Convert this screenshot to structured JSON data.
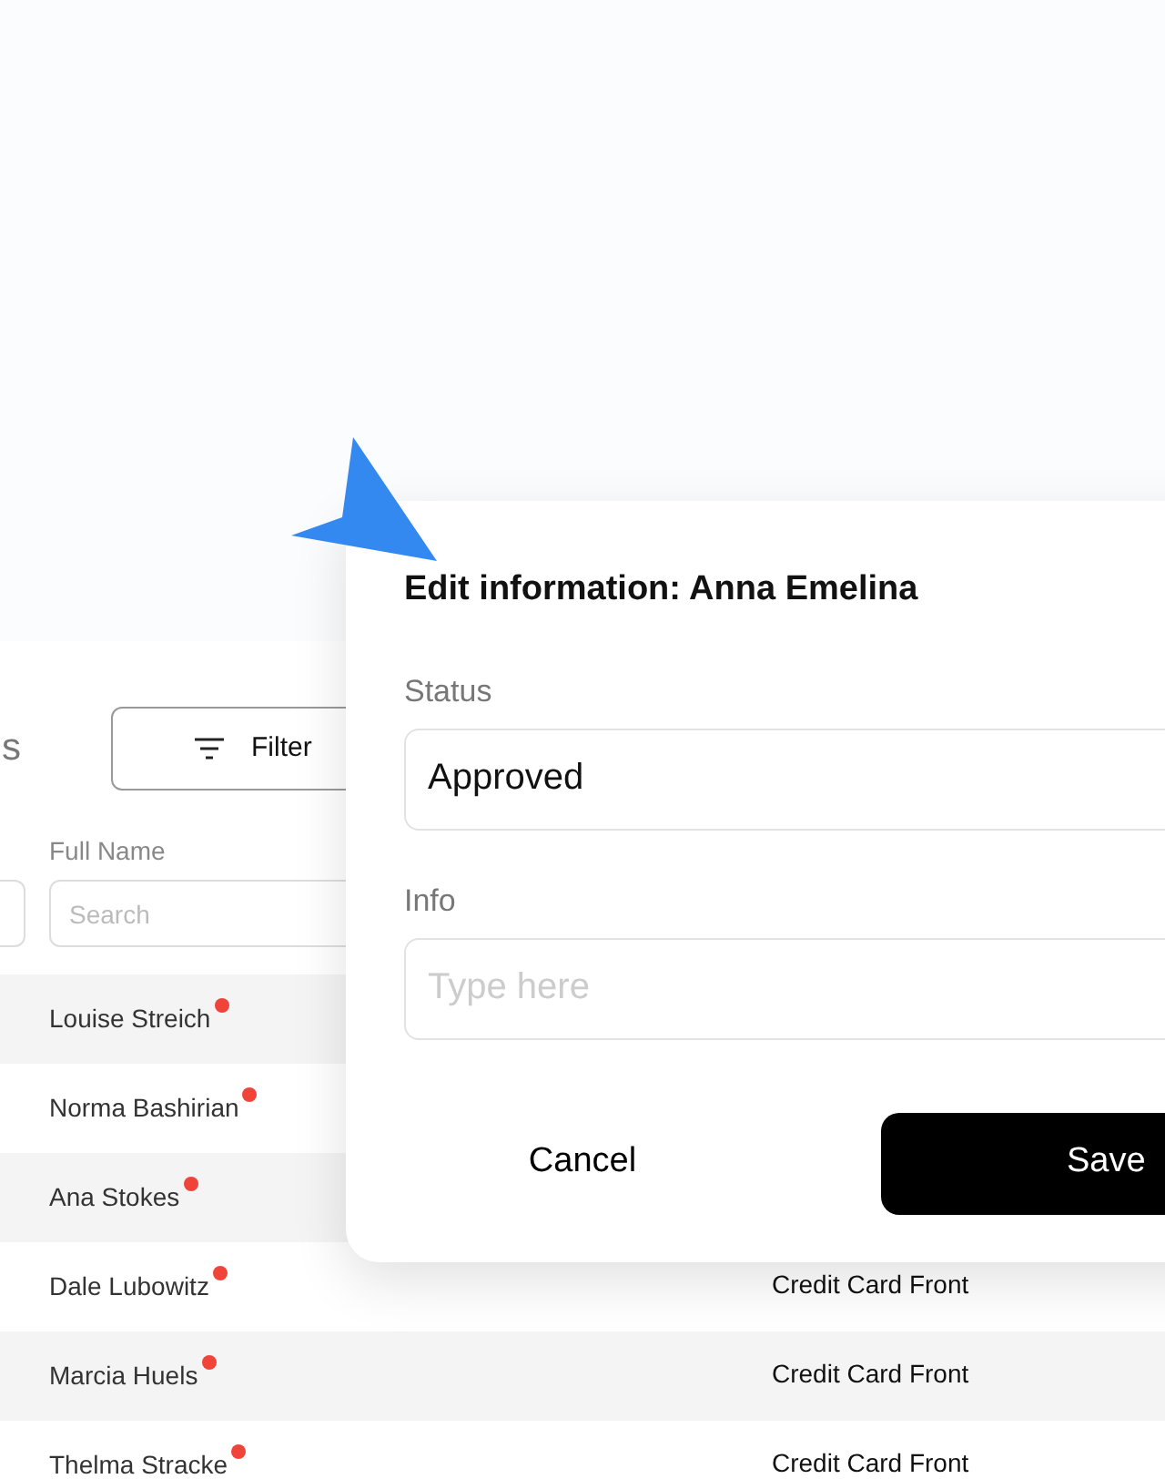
{
  "page_heading": "s",
  "filter_button": {
    "label": "Filter"
  },
  "table": {
    "column": {
      "label": "Full Name",
      "search_placeholder": "Search"
    },
    "rows": [
      {
        "full_name": "Louise Streich",
        "flagged": true
      },
      {
        "full_name": "Norma Bashirian",
        "flagged": true
      },
      {
        "full_name": "Ana Stokes",
        "flagged": true
      },
      {
        "full_name": "Dale Lubowitz",
        "flagged": true,
        "column_3": "Credit Card Front"
      },
      {
        "full_name": "Marcia Huels",
        "flagged": true,
        "column_3": "Credit Card Front"
      },
      {
        "full_name": "Thelma Stracke",
        "flagged": true,
        "column_3": "Credit Card Front"
      }
    ]
  },
  "dialog": {
    "title": "Edit information: Anna Emelina",
    "fields": [
      {
        "label": "Status",
        "value": "Approved"
      },
      {
        "label": "Info",
        "placeholder": "Type here"
      }
    ],
    "buttons": [
      {
        "label": "Cancel",
        "kind": "secondary"
      },
      {
        "label": "Save",
        "kind": "primary"
      }
    ]
  }
}
